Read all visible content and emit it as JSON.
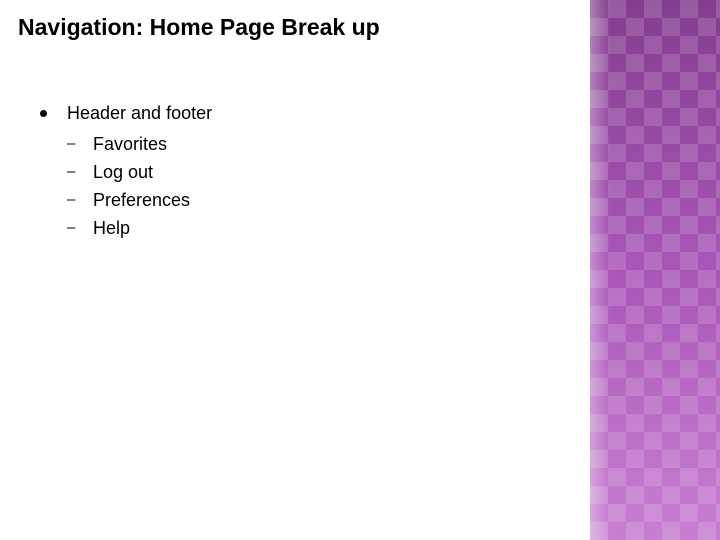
{
  "title": "Navigation: Home Page Break up",
  "list": {
    "item": "Header and footer",
    "subitems": [
      "Favorites",
      "Log out",
      "Preferences",
      "Help"
    ]
  }
}
